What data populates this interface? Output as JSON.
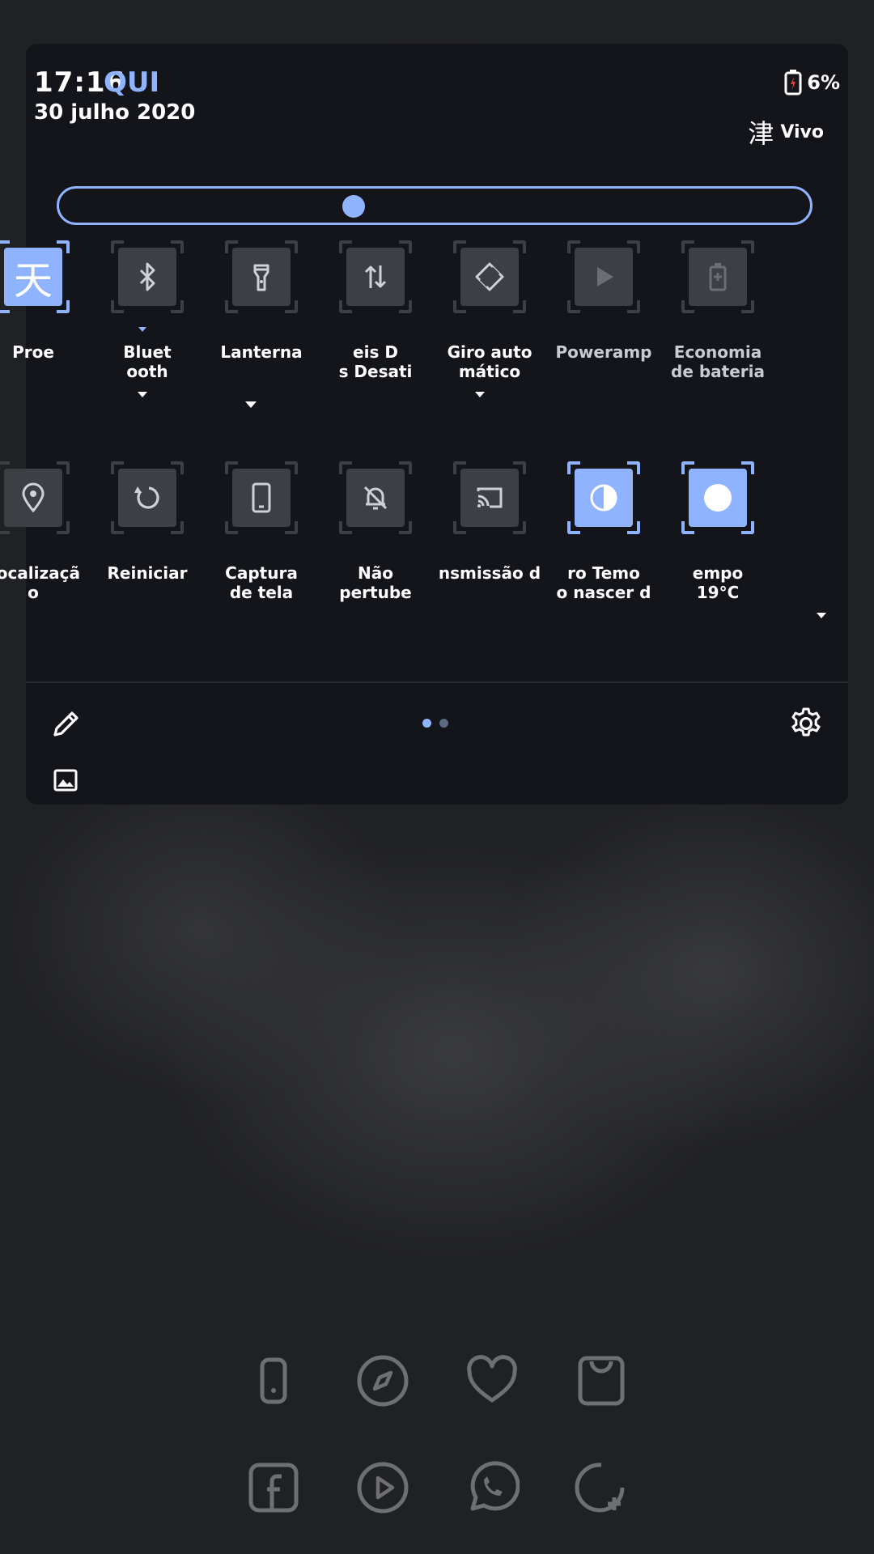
{
  "status": {
    "time": "17:16",
    "day": "QUI",
    "date": "30 julho 2020",
    "battery": "6%",
    "carrier_glyph": "津",
    "carrier": "Vivo"
  },
  "brightness": {
    "level": 0.39
  },
  "tiles": [
    {
      "label": "Proe",
      "icon": "weather-kanji",
      "glyph": "天",
      "active": true
    },
    {
      "label": "Bluet\nooth",
      "icon": "bluetooth-icon",
      "active": false
    },
    {
      "label": "Lanterna",
      "icon": "flashlight-icon",
      "active": false
    },
    {
      "label": "eis   D\ns     Desati",
      "icon": "data-transfer-icon",
      "active": false
    },
    {
      "label": "Giro auto\nmático",
      "icon": "auto-rotate-icon",
      "active": false
    },
    {
      "label": "Poweramp",
      "icon": "play-icon",
      "active": false
    },
    {
      "label": "Economia\nde bateria",
      "icon": "battery-saver-icon",
      "active": false
    },
    {
      "label": "Localizaçã\no",
      "icon": "location-icon",
      "active": false
    },
    {
      "label": "Reiniciar",
      "icon": "restart-icon",
      "active": false
    },
    {
      "label": "Captura\nde tela",
      "icon": "screenshot-icon",
      "active": false
    },
    {
      "label": "Não\npertube",
      "icon": "do-not-disturb-icon",
      "active": false
    },
    {
      "label": "nsmissão d",
      "icon": "cast-icon",
      "active": false
    },
    {
      "label": "ro      Temo\no nascer d",
      "icon": "contrast-icon",
      "active": true
    },
    {
      "label": "empo\n19°C",
      "icon": "circle-icon",
      "active": true
    }
  ],
  "pager": {
    "pages": 2,
    "current": 1
  },
  "dock": {
    "row1": [
      "phone-icon",
      "compass-icon",
      "heart-icon",
      "shopping-bag-icon"
    ],
    "row2": [
      "facebook-icon",
      "play-circle-icon",
      "whatsapp-icon",
      "add-app-icon"
    ]
  },
  "colors": {
    "accent": "#8fb3ff",
    "tile_inactive": "#3e3f44",
    "panel": "#14151a"
  }
}
